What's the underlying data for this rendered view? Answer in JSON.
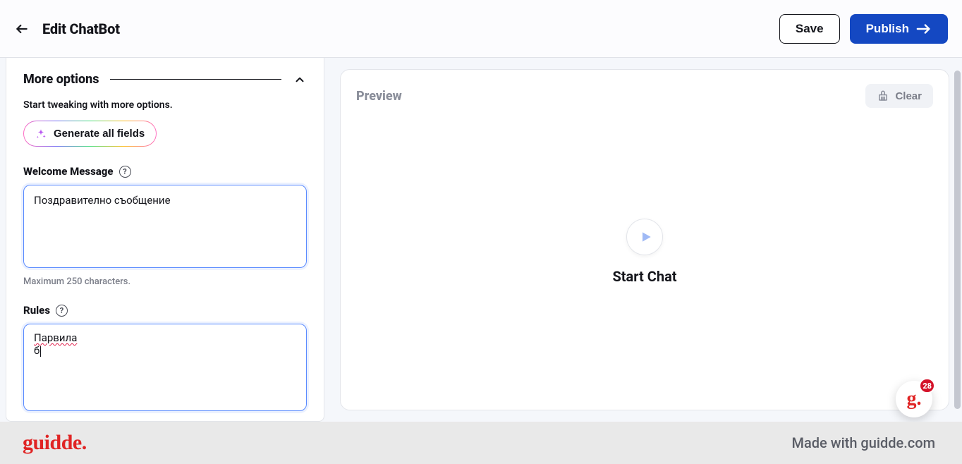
{
  "header": {
    "title": "Edit ChatBot",
    "save_label": "Save",
    "publish_label": "Publish"
  },
  "section": {
    "title": "More options",
    "desc": "Start tweaking with more options.",
    "generate_label": "Generate all fields"
  },
  "welcome": {
    "label": "Welcome Message",
    "value": "Поздравително съобщение",
    "helper": "Maximum 250 characters."
  },
  "rules": {
    "label": "Rules",
    "line1": "Парвила",
    "line2": "б"
  },
  "preview": {
    "title": "Preview",
    "clear_label": "Clear",
    "start_label": "Start Chat"
  },
  "footer": {
    "logo": "guidde.",
    "made_with": "Made with guidde.com"
  },
  "badge": {
    "count": "28"
  }
}
